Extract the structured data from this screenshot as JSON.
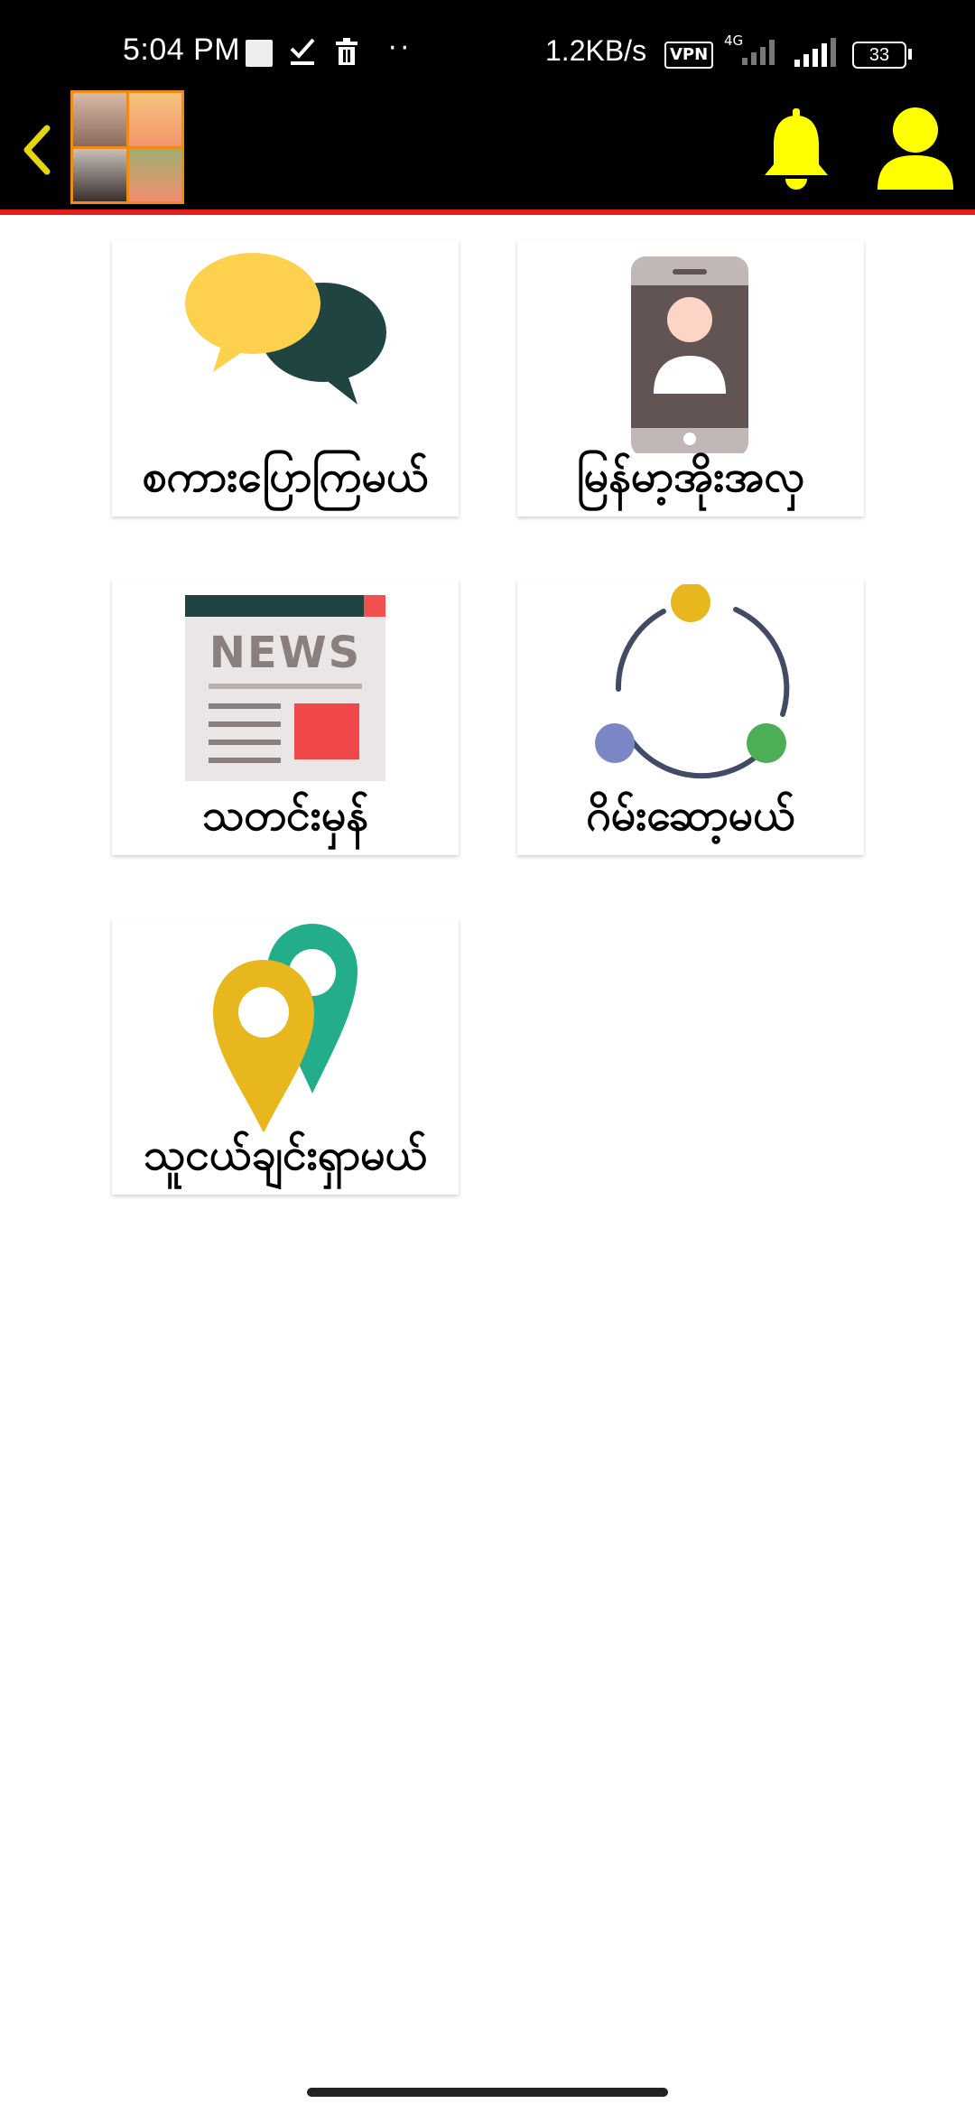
{
  "status_bar": {
    "time": "5:04 PM",
    "dots": "··",
    "network_speed": "1.2KB/s",
    "vpn_label": "VPN",
    "network_type": "4G",
    "battery": "33"
  },
  "header": {
    "back_icon": "chevron-left-icon",
    "notification_icon": "bell-icon",
    "profile_icon": "user-icon",
    "accent_color": "#ffff00",
    "divider_color": "#e31e1e"
  },
  "menu": {
    "items": [
      {
        "label": "စကားပြောကြမယ်",
        "icon": "chat-bubbles-icon"
      },
      {
        "label": "မြန်မာ့အိုးအလှ",
        "icon": "phone-contact-icon"
      },
      {
        "label": "သတင်းမှန်",
        "icon": "news-icon"
      },
      {
        "label": "ဂိမ်းဆော့မယ်",
        "icon": "game-connect-icon"
      },
      {
        "label": "သူငယ်ချင်းရှာမယ်",
        "icon": "location-pins-icon"
      }
    ],
    "news_icon_text": "NEWS"
  }
}
